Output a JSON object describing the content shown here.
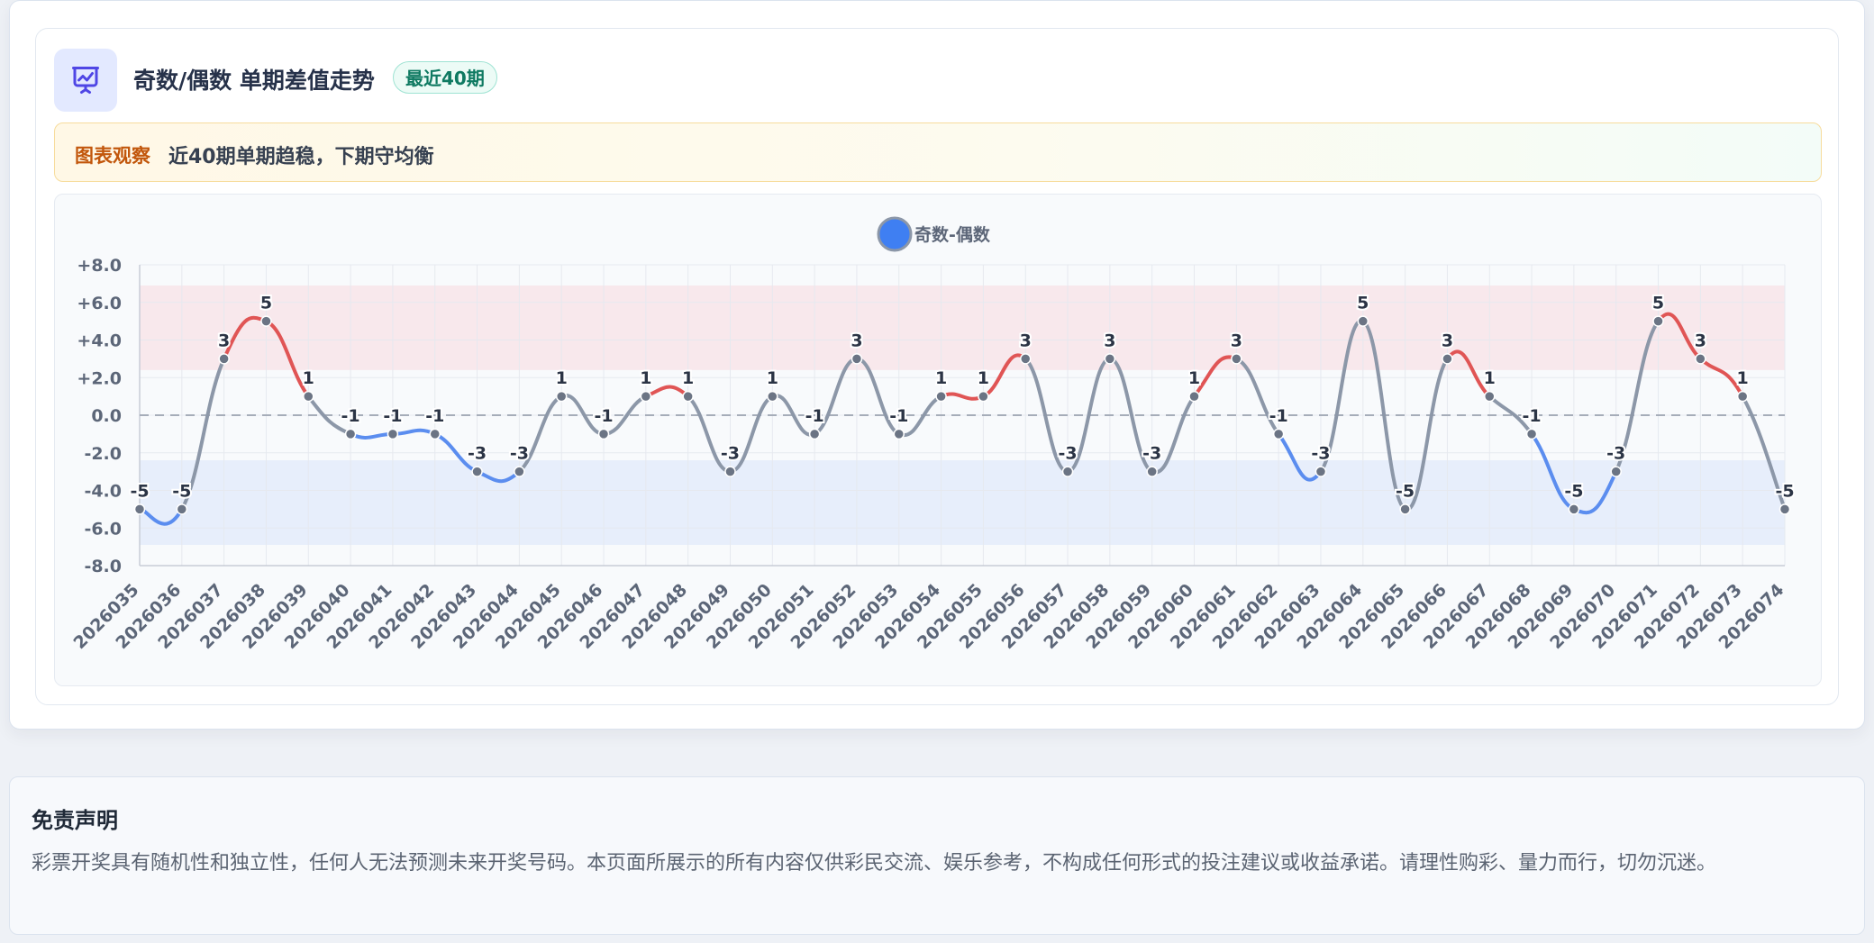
{
  "card": {
    "title": "奇数/偶数 单期差值走势",
    "badge": "最近40期",
    "icon": "presentation-chart-icon"
  },
  "observation": {
    "label": "图表观察",
    "text": "近40期单期趋稳，下期守均衡"
  },
  "colors": {
    "above": "#e05555",
    "below": "#5b8def",
    "neutral": "#8c97a8",
    "upper_band": "#f8e8ec",
    "lower_band": "#e7eefb",
    "legend_dot": "#3f7ff2"
  },
  "chart_data": {
    "type": "line",
    "title": "",
    "xlabel": "",
    "ylabel": "",
    "ylim": [
      -8,
      8
    ],
    "yticks": [
      "+8.0",
      "+6.0",
      "+4.0",
      "+2.0",
      "0.0",
      "-2.0",
      "-4.0",
      "-6.0",
      "-8.0"
    ],
    "ytick_values": [
      8,
      6,
      4,
      2,
      0,
      -2,
      -4,
      -6,
      -8
    ],
    "bands": [
      {
        "from": 2.4,
        "to": 6.9,
        "kind": "upper"
      },
      {
        "from": -6.9,
        "to": -2.4,
        "kind": "lower"
      }
    ],
    "reference_line": 0,
    "grid": true,
    "legend_position": "top-center",
    "categories": [
      "2026035",
      "2026036",
      "2026037",
      "2026038",
      "2026039",
      "2026040",
      "2026041",
      "2026042",
      "2026043",
      "2026044",
      "2026045",
      "2026046",
      "2026047",
      "2026048",
      "2026049",
      "2026050",
      "2026051",
      "2026052",
      "2026053",
      "2026054",
      "2026055",
      "2026056",
      "2026057",
      "2026058",
      "2026059",
      "2026060",
      "2026061",
      "2026062",
      "2026063",
      "2026064",
      "2026065",
      "2026066",
      "2026067",
      "2026068",
      "2026069",
      "2026070",
      "2026071",
      "2026072",
      "2026073",
      "2026074"
    ],
    "series": [
      {
        "name": "奇数-偶数",
        "values": [
          -5,
          -5,
          3,
          5,
          1,
          -1,
          -1,
          -1,
          -3,
          -3,
          1,
          -1,
          1,
          1,
          -3,
          1,
          -1,
          3,
          -1,
          1,
          1,
          3,
          -3,
          3,
          -3,
          1,
          3,
          -1,
          -3,
          5,
          -5,
          3,
          1,
          -1,
          -5,
          -3,
          5,
          3,
          1,
          -5
        ],
        "labels": [
          "-5",
          "-5",
          "3",
          "5",
          "1",
          "-1",
          "-1",
          "-1",
          "-3",
          "-3",
          "1",
          "-1",
          "1",
          "1",
          "-3",
          "1",
          "-1",
          "3",
          "-1",
          "1",
          "1",
          "3",
          "-3",
          "3",
          "-3",
          "1",
          "3",
          "-1",
          "-3",
          "5",
          "-5",
          "3",
          "1",
          "-1",
          "-5",
          "-3",
          "5",
          "3",
          "1",
          "-5"
        ]
      }
    ]
  },
  "disclaimer": {
    "title": "免责声明",
    "text": "彩票开奖具有随机性和独立性，任何人无法预测未来开奖号码。本页面所展示的所有内容仅供彩民交流、娱乐参考，不构成任何形式的投注建议或收益承诺。请理性购彩、量力而行，切勿沉迷。"
  }
}
